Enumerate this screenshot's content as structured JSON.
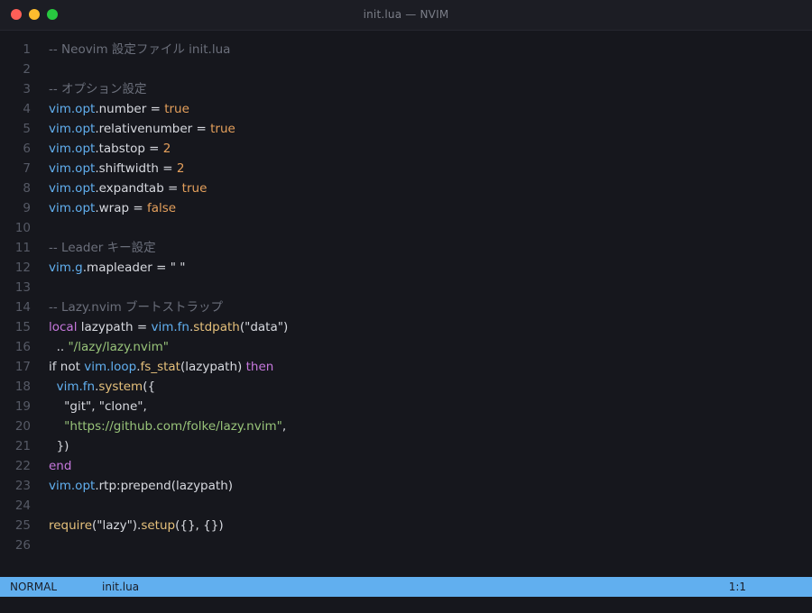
{
  "window": {
    "title": "init.lua — NVIM"
  },
  "colors": {
    "comment": "#6b6f7b",
    "vimns": "#61afef",
    "text": "#d7d9df",
    "bool": "#e5a05c",
    "number": "#e5a05c",
    "string": "#98c379",
    "keyword": "#c678dd",
    "func": "#e5c07b",
    "linenr": "#565a66",
    "status_bg": "#61afef"
  },
  "lines": [
    {
      "n": "1",
      "tokens": [
        {
          "t": "-- Neovim 設定ファイル init.lua",
          "c": "comment"
        }
      ]
    },
    {
      "n": "2",
      "tokens": []
    },
    {
      "n": "3",
      "tokens": [
        {
          "t": "-- オプション設定",
          "c": "comment"
        }
      ]
    },
    {
      "n": "4",
      "tokens": [
        {
          "t": "vim.opt",
          "c": "vimns"
        },
        {
          "t": ".number = ",
          "c": "text"
        },
        {
          "t": "true",
          "c": "bool"
        }
      ]
    },
    {
      "n": "5",
      "tokens": [
        {
          "t": "vim.opt",
          "c": "vimns"
        },
        {
          "t": ".relativenumber = ",
          "c": "text"
        },
        {
          "t": "true",
          "c": "bool"
        }
      ]
    },
    {
      "n": "6",
      "tokens": [
        {
          "t": "vim.opt",
          "c": "vimns"
        },
        {
          "t": ".tabstop = ",
          "c": "text"
        },
        {
          "t": "2",
          "c": "number"
        }
      ]
    },
    {
      "n": "7",
      "tokens": [
        {
          "t": "vim.opt",
          "c": "vimns"
        },
        {
          "t": ".shiftwidth = ",
          "c": "text"
        },
        {
          "t": "2",
          "c": "number"
        }
      ]
    },
    {
      "n": "8",
      "tokens": [
        {
          "t": "vim.opt",
          "c": "vimns"
        },
        {
          "t": ".expandtab = ",
          "c": "text"
        },
        {
          "t": "true",
          "c": "bool"
        }
      ]
    },
    {
      "n": "9",
      "tokens": [
        {
          "t": "vim.opt",
          "c": "vimns"
        },
        {
          "t": ".wrap = ",
          "c": "text"
        },
        {
          "t": "false",
          "c": "bool"
        }
      ]
    },
    {
      "n": "10",
      "tokens": []
    },
    {
      "n": "11",
      "tokens": [
        {
          "t": "-- Leader キー設定",
          "c": "comment"
        }
      ]
    },
    {
      "n": "12",
      "tokens": [
        {
          "t": "vim.g",
          "c": "vimns"
        },
        {
          "t": ".mapleader = \" \"",
          "c": "text"
        }
      ]
    },
    {
      "n": "13",
      "tokens": []
    },
    {
      "n": "14",
      "tokens": [
        {
          "t": "-- Lazy.nvim ブートストラップ",
          "c": "comment"
        }
      ]
    },
    {
      "n": "15",
      "tokens": [
        {
          "t": "local",
          "c": "keyword"
        },
        {
          "t": " lazypath = ",
          "c": "text"
        },
        {
          "t": "vim.fn",
          "c": "vimns"
        },
        {
          "t": ".",
          "c": "text"
        },
        {
          "t": "stdpath",
          "c": "func"
        },
        {
          "t": "(\"data\")",
          "c": "text"
        }
      ]
    },
    {
      "n": "16",
      "tokens": [
        {
          "t": "  .. ",
          "c": "text"
        },
        {
          "t": "\"/lazy/lazy.nvim\"",
          "c": "string"
        }
      ]
    },
    {
      "n": "17",
      "tokens": [
        {
          "t": "if not ",
          "c": "text"
        },
        {
          "t": "vim.loop",
          "c": "vimns"
        },
        {
          "t": ".",
          "c": "text"
        },
        {
          "t": "fs_stat",
          "c": "func"
        },
        {
          "t": "(lazypath) ",
          "c": "text"
        },
        {
          "t": "then",
          "c": "keyword"
        }
      ]
    },
    {
      "n": "18",
      "tokens": [
        {
          "t": "  ",
          "c": "text"
        },
        {
          "t": "vim.fn",
          "c": "vimns"
        },
        {
          "t": ".",
          "c": "text"
        },
        {
          "t": "system",
          "c": "func"
        },
        {
          "t": "({",
          "c": "text"
        }
      ]
    },
    {
      "n": "19",
      "tokens": [
        {
          "t": "    \"git\", \"clone\",",
          "c": "text"
        }
      ]
    },
    {
      "n": "20",
      "tokens": [
        {
          "t": "    ",
          "c": "text"
        },
        {
          "t": "\"https://github.com/folke/lazy.nvim\"",
          "c": "string"
        },
        {
          "t": ",",
          "c": "text"
        }
      ]
    },
    {
      "n": "21",
      "tokens": [
        {
          "t": "  })",
          "c": "text"
        }
      ]
    },
    {
      "n": "22",
      "tokens": [
        {
          "t": "end",
          "c": "keyword"
        }
      ]
    },
    {
      "n": "23",
      "tokens": [
        {
          "t": "vim.opt",
          "c": "vimns"
        },
        {
          "t": ".rtp:prepend(lazypath)",
          "c": "text"
        }
      ]
    },
    {
      "n": "24",
      "tokens": []
    },
    {
      "n": "25",
      "tokens": [
        {
          "t": "require",
          "c": "func"
        },
        {
          "t": "(\"lazy\").",
          "c": "text"
        },
        {
          "t": "setup",
          "c": "func"
        },
        {
          "t": "({}, {})",
          "c": "text"
        }
      ]
    },
    {
      "n": "26",
      "tokens": []
    }
  ],
  "status": {
    "mode": "NORMAL",
    "file": "init.lua",
    "position": "1:1"
  }
}
